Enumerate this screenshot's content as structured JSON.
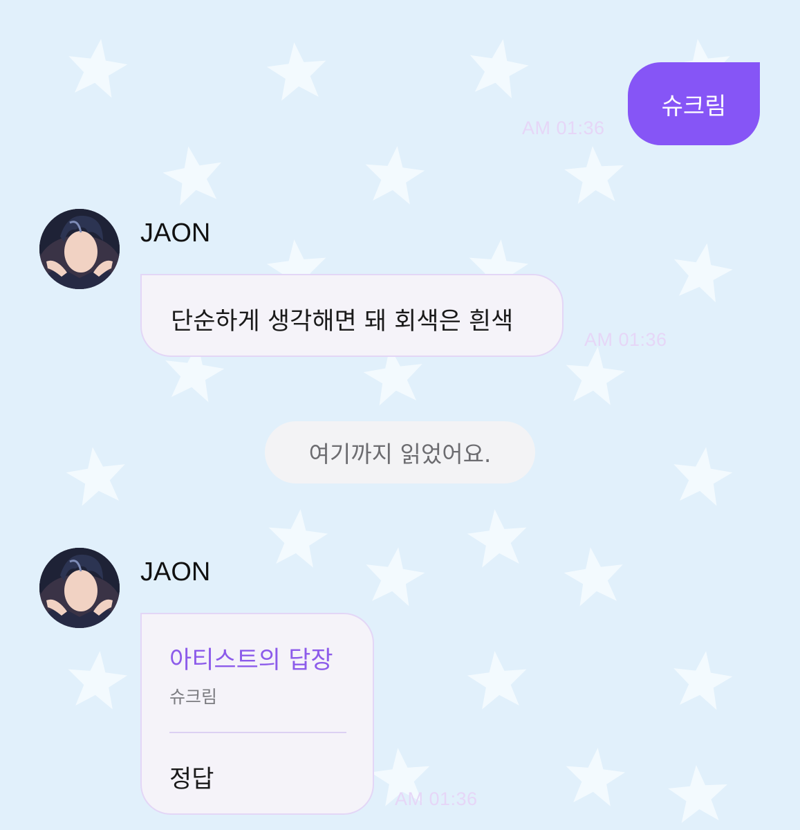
{
  "colors": {
    "background": "#e1f0fb",
    "star": "#f3fafe",
    "outgoing_bubble": "#8655f6",
    "incoming_bubble": "#f5f3f9",
    "incoming_border": "#e3d6f6",
    "timestamp": "#e6d6f7",
    "accent_title": "#8c5bea"
  },
  "messages": [
    {
      "type": "outgoing",
      "text": "슈크림",
      "time": "AM 01:36"
    },
    {
      "type": "incoming",
      "sender": "JAON",
      "avatar_icon": "profile-avatar",
      "text": "단순하게 생각해면 돼 회색은 흰색",
      "time": "AM 01:36"
    },
    {
      "type": "read-marker",
      "text": "여기까지 읽었어요."
    },
    {
      "type": "artist-reply",
      "sender": "JAON",
      "avatar_icon": "profile-avatar",
      "title": "아티스트의 답장",
      "quoted": "슈크림",
      "text": "정답",
      "time": "AM 01:36"
    }
  ]
}
